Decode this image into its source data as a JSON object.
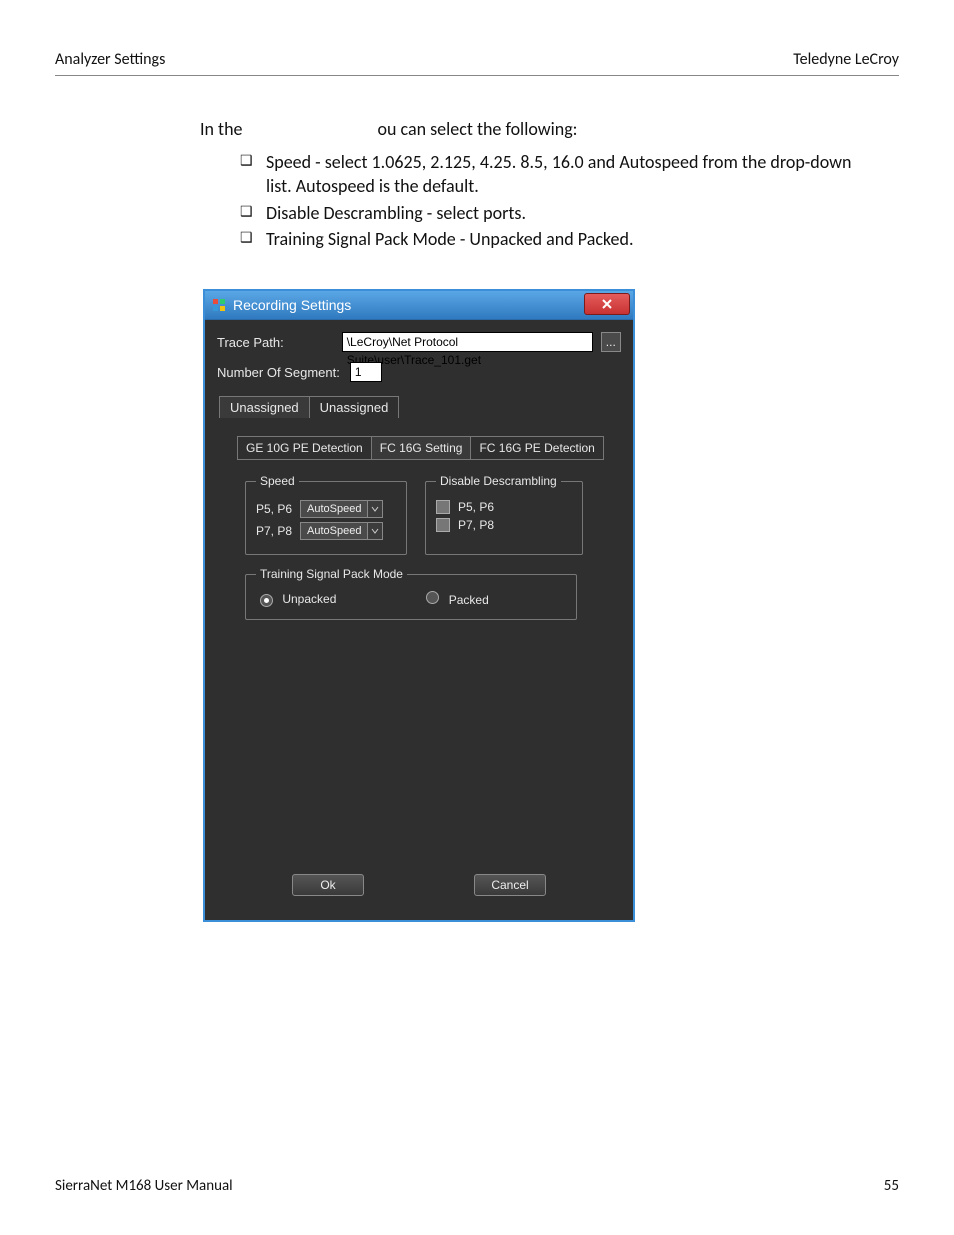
{
  "header": {
    "left": "Analyzer Settings",
    "right": "Teledyne LeCroy"
  },
  "intro": {
    "prefix": "In the",
    "suffix": "ou can select the following:"
  },
  "bullets": [
    "Speed - select 1.0625, 2.125, 4.25. 8.5, 16.0 and Autospeed from the drop-down list. Autospeed is the default.",
    "Disable Descrambling - select ports.",
    "Training Signal Pack Mode - Unpacked and Packed."
  ],
  "dialog": {
    "title": "Recording Settings",
    "trace_path_label": "Trace Path:",
    "trace_path_value": "\\LeCroy\\Net Protocol Suite\\user\\Trace_101.get",
    "browse_label": "...",
    "num_segment_label": "Number Of Segment:",
    "num_segment_value": "1",
    "top_tabs": [
      "Unassigned",
      "Unassigned"
    ],
    "sub_tabs": [
      "GE 10G PE Detection",
      "FC 16G Setting",
      "FC 16G PE Detection"
    ],
    "speed_group": {
      "legend": "Speed",
      "rows": [
        {
          "ports": "P5, P6",
          "value": "AutoSpeed"
        },
        {
          "ports": "P7, P8",
          "value": "AutoSpeed"
        }
      ]
    },
    "descramble_group": {
      "legend": "Disable Descrambling",
      "rows": [
        "P5, P6",
        "P7, P8"
      ]
    },
    "training_group": {
      "legend": "Training Signal Pack Mode",
      "options": [
        "Unpacked",
        "Packed"
      ],
      "selected": "Unpacked"
    },
    "buttons": {
      "ok": "Ok",
      "cancel": "Cancel"
    }
  },
  "footer": {
    "left": "SierraNet M168 User Manual",
    "right": "55"
  }
}
